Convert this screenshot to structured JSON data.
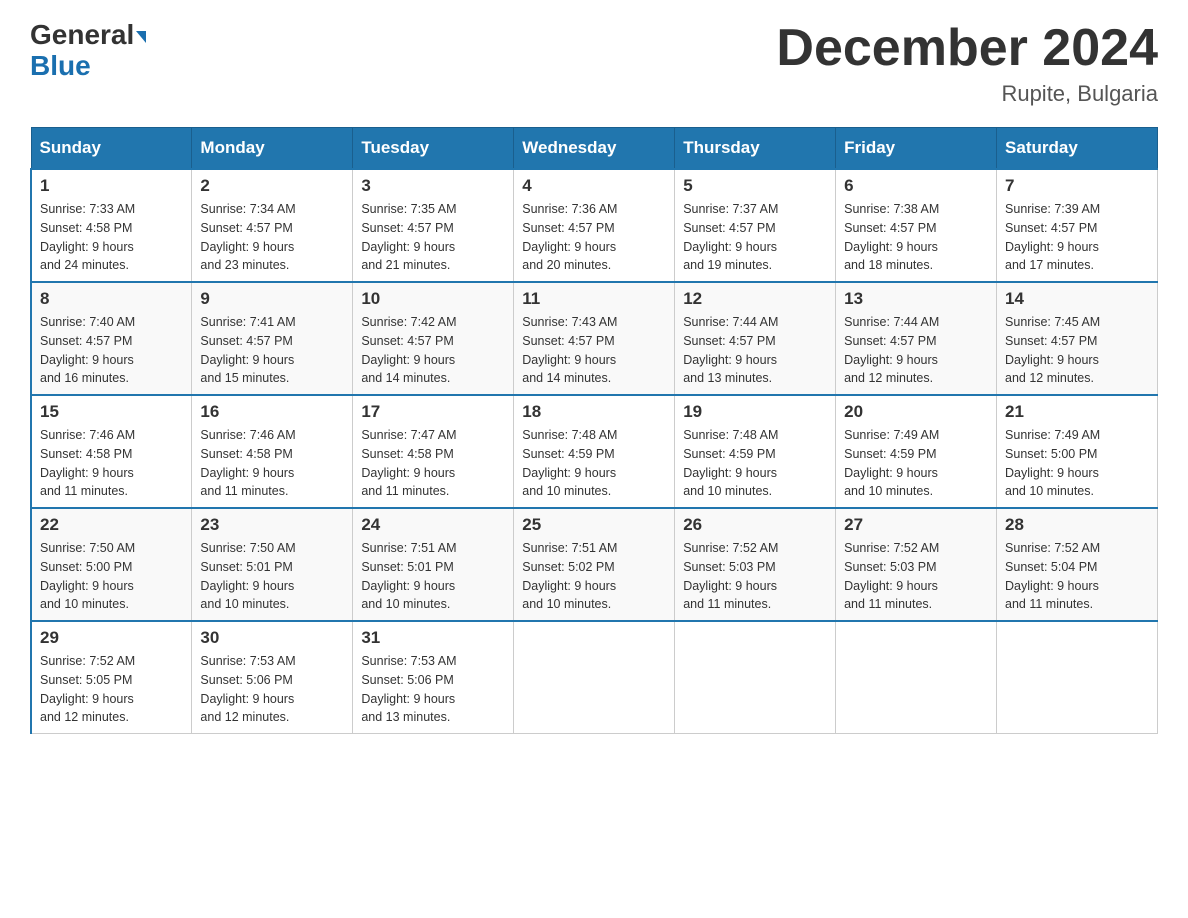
{
  "header": {
    "logo_line1": "General",
    "logo_line2": "Blue",
    "month_title": "December 2024",
    "location": "Rupite, Bulgaria"
  },
  "weekdays": [
    "Sunday",
    "Monday",
    "Tuesday",
    "Wednesday",
    "Thursday",
    "Friday",
    "Saturday"
  ],
  "weeks": [
    [
      {
        "day": "1",
        "sunrise": "7:33 AM",
        "sunset": "4:58 PM",
        "daylight": "9 hours and 24 minutes."
      },
      {
        "day": "2",
        "sunrise": "7:34 AM",
        "sunset": "4:57 PM",
        "daylight": "9 hours and 23 minutes."
      },
      {
        "day": "3",
        "sunrise": "7:35 AM",
        "sunset": "4:57 PM",
        "daylight": "9 hours and 21 minutes."
      },
      {
        "day": "4",
        "sunrise": "7:36 AM",
        "sunset": "4:57 PM",
        "daylight": "9 hours and 20 minutes."
      },
      {
        "day": "5",
        "sunrise": "7:37 AM",
        "sunset": "4:57 PM",
        "daylight": "9 hours and 19 minutes."
      },
      {
        "day": "6",
        "sunrise": "7:38 AM",
        "sunset": "4:57 PM",
        "daylight": "9 hours and 18 minutes."
      },
      {
        "day": "7",
        "sunrise": "7:39 AM",
        "sunset": "4:57 PM",
        "daylight": "9 hours and 17 minutes."
      }
    ],
    [
      {
        "day": "8",
        "sunrise": "7:40 AM",
        "sunset": "4:57 PM",
        "daylight": "9 hours and 16 minutes."
      },
      {
        "day": "9",
        "sunrise": "7:41 AM",
        "sunset": "4:57 PM",
        "daylight": "9 hours and 15 minutes."
      },
      {
        "day": "10",
        "sunrise": "7:42 AM",
        "sunset": "4:57 PM",
        "daylight": "9 hours and 14 minutes."
      },
      {
        "day": "11",
        "sunrise": "7:43 AM",
        "sunset": "4:57 PM",
        "daylight": "9 hours and 14 minutes."
      },
      {
        "day": "12",
        "sunrise": "7:44 AM",
        "sunset": "4:57 PM",
        "daylight": "9 hours and 13 minutes."
      },
      {
        "day": "13",
        "sunrise": "7:44 AM",
        "sunset": "4:57 PM",
        "daylight": "9 hours and 12 minutes."
      },
      {
        "day": "14",
        "sunrise": "7:45 AM",
        "sunset": "4:57 PM",
        "daylight": "9 hours and 12 minutes."
      }
    ],
    [
      {
        "day": "15",
        "sunrise": "7:46 AM",
        "sunset": "4:58 PM",
        "daylight": "9 hours and 11 minutes."
      },
      {
        "day": "16",
        "sunrise": "7:46 AM",
        "sunset": "4:58 PM",
        "daylight": "9 hours and 11 minutes."
      },
      {
        "day": "17",
        "sunrise": "7:47 AM",
        "sunset": "4:58 PM",
        "daylight": "9 hours and 11 minutes."
      },
      {
        "day": "18",
        "sunrise": "7:48 AM",
        "sunset": "4:59 PM",
        "daylight": "9 hours and 10 minutes."
      },
      {
        "day": "19",
        "sunrise": "7:48 AM",
        "sunset": "4:59 PM",
        "daylight": "9 hours and 10 minutes."
      },
      {
        "day": "20",
        "sunrise": "7:49 AM",
        "sunset": "4:59 PM",
        "daylight": "9 hours and 10 minutes."
      },
      {
        "day": "21",
        "sunrise": "7:49 AM",
        "sunset": "5:00 PM",
        "daylight": "9 hours and 10 minutes."
      }
    ],
    [
      {
        "day": "22",
        "sunrise": "7:50 AM",
        "sunset": "5:00 PM",
        "daylight": "9 hours and 10 minutes."
      },
      {
        "day": "23",
        "sunrise": "7:50 AM",
        "sunset": "5:01 PM",
        "daylight": "9 hours and 10 minutes."
      },
      {
        "day": "24",
        "sunrise": "7:51 AM",
        "sunset": "5:01 PM",
        "daylight": "9 hours and 10 minutes."
      },
      {
        "day": "25",
        "sunrise": "7:51 AM",
        "sunset": "5:02 PM",
        "daylight": "9 hours and 10 minutes."
      },
      {
        "day": "26",
        "sunrise": "7:52 AM",
        "sunset": "5:03 PM",
        "daylight": "9 hours and 11 minutes."
      },
      {
        "day": "27",
        "sunrise": "7:52 AM",
        "sunset": "5:03 PM",
        "daylight": "9 hours and 11 minutes."
      },
      {
        "day": "28",
        "sunrise": "7:52 AM",
        "sunset": "5:04 PM",
        "daylight": "9 hours and 11 minutes."
      }
    ],
    [
      {
        "day": "29",
        "sunrise": "7:52 AM",
        "sunset": "5:05 PM",
        "daylight": "9 hours and 12 minutes."
      },
      {
        "day": "30",
        "sunrise": "7:53 AM",
        "sunset": "5:06 PM",
        "daylight": "9 hours and 12 minutes."
      },
      {
        "day": "31",
        "sunrise": "7:53 AM",
        "sunset": "5:06 PM",
        "daylight": "9 hours and 13 minutes."
      },
      null,
      null,
      null,
      null
    ]
  ],
  "labels": {
    "sunrise": "Sunrise:",
    "sunset": "Sunset:",
    "daylight": "Daylight:"
  }
}
